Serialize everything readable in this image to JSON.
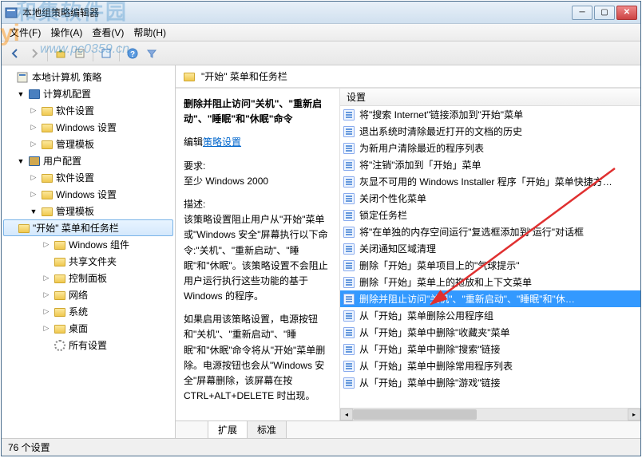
{
  "window": {
    "title": "本地组策略编辑器"
  },
  "menu": {
    "file": "文件(F)",
    "action": "操作(A)",
    "view": "查看(V)",
    "help": "帮助(H)"
  },
  "watermark": {
    "brand": "和集软件园",
    "url": "www.pc0359.cn",
    "char": "yi"
  },
  "tree": {
    "root": "本地计算机 策略",
    "computer_config": "计算机配置",
    "software_settings": "软件设置",
    "windows_settings": "Windows 设置",
    "admin_templates": "管理模板",
    "user_config": "用户配置",
    "start_taskbar": "\"开始\" 菜单和任务栏",
    "windows_components": "Windows 组件",
    "shared_folders": "共享文件夹",
    "control_panel": "控制面板",
    "network": "网络",
    "system": "系统",
    "desktop": "桌面",
    "all_settings": "所有设置"
  },
  "right": {
    "header": "\"开始\" 菜单和任务栏",
    "col_setting": "设置"
  },
  "detail": {
    "title": "删除并阻止访问\"关机\"、\"重新启动\"、\"睡眠\"和\"休眠\"命令",
    "edit_prefix": "编辑",
    "edit_link": "策略设置",
    "req_label": "要求:",
    "req_value": "至少 Windows 2000",
    "desc_label": "描述:",
    "desc_p1": "该策略设置阻止用户从\"开始\"菜单或\"Windows 安全\"屏幕执行以下命令:\"关机\"、\"重新启动\"、\"睡眠\"和\"休眠\"。该策略设置不会阻止用户运行执行这些功能的基于 Windows 的程序。",
    "desc_p2": "如果启用该策略设置，电源按钮和\"关机\"、\"重新启动\"、\"睡眠\"和\"休眠\"命令将从\"开始\"菜单删除。电源按钮也会从\"Windows 安全\"屏幕删除，该屏幕在按 CTRL+ALT+DELETE 时出现。"
  },
  "settings": [
    "将\"搜索 Internet\"链接添加到\"开始\"菜单",
    "退出系统时清除最近打开的文档的历史",
    "为新用户清除最近的程序列表",
    "将\"注销\"添加到「开始」菜单",
    "灰显不可用的 Windows Installer 程序「开始」菜单快捷方…",
    "关闭个性化菜单",
    "锁定任务栏",
    "将\"在单独的内存空间运行\"复选框添加到\"运行\"对话框",
    "关闭通知区域清理",
    "删除「开始」菜单项目上的\"气球提示\"",
    "删除「开始」菜单上的拖放和上下文菜单",
    "删除并阻止访问\"关机\"、\"重新启动\"、\"睡眠\"和\"休…",
    "从「开始」菜单删除公用程序组",
    "从「开始」菜单中删除\"收藏夹\"菜单",
    "从「开始」菜单中删除\"搜索\"链接",
    "从「开始」菜单中删除常用程序列表",
    "从「开始」菜单中删除\"游戏\"链接"
  ],
  "selected_setting_index": 11,
  "tabs": {
    "extended": "扩展",
    "standard": "标准"
  },
  "status": {
    "count": "76 个设置"
  }
}
